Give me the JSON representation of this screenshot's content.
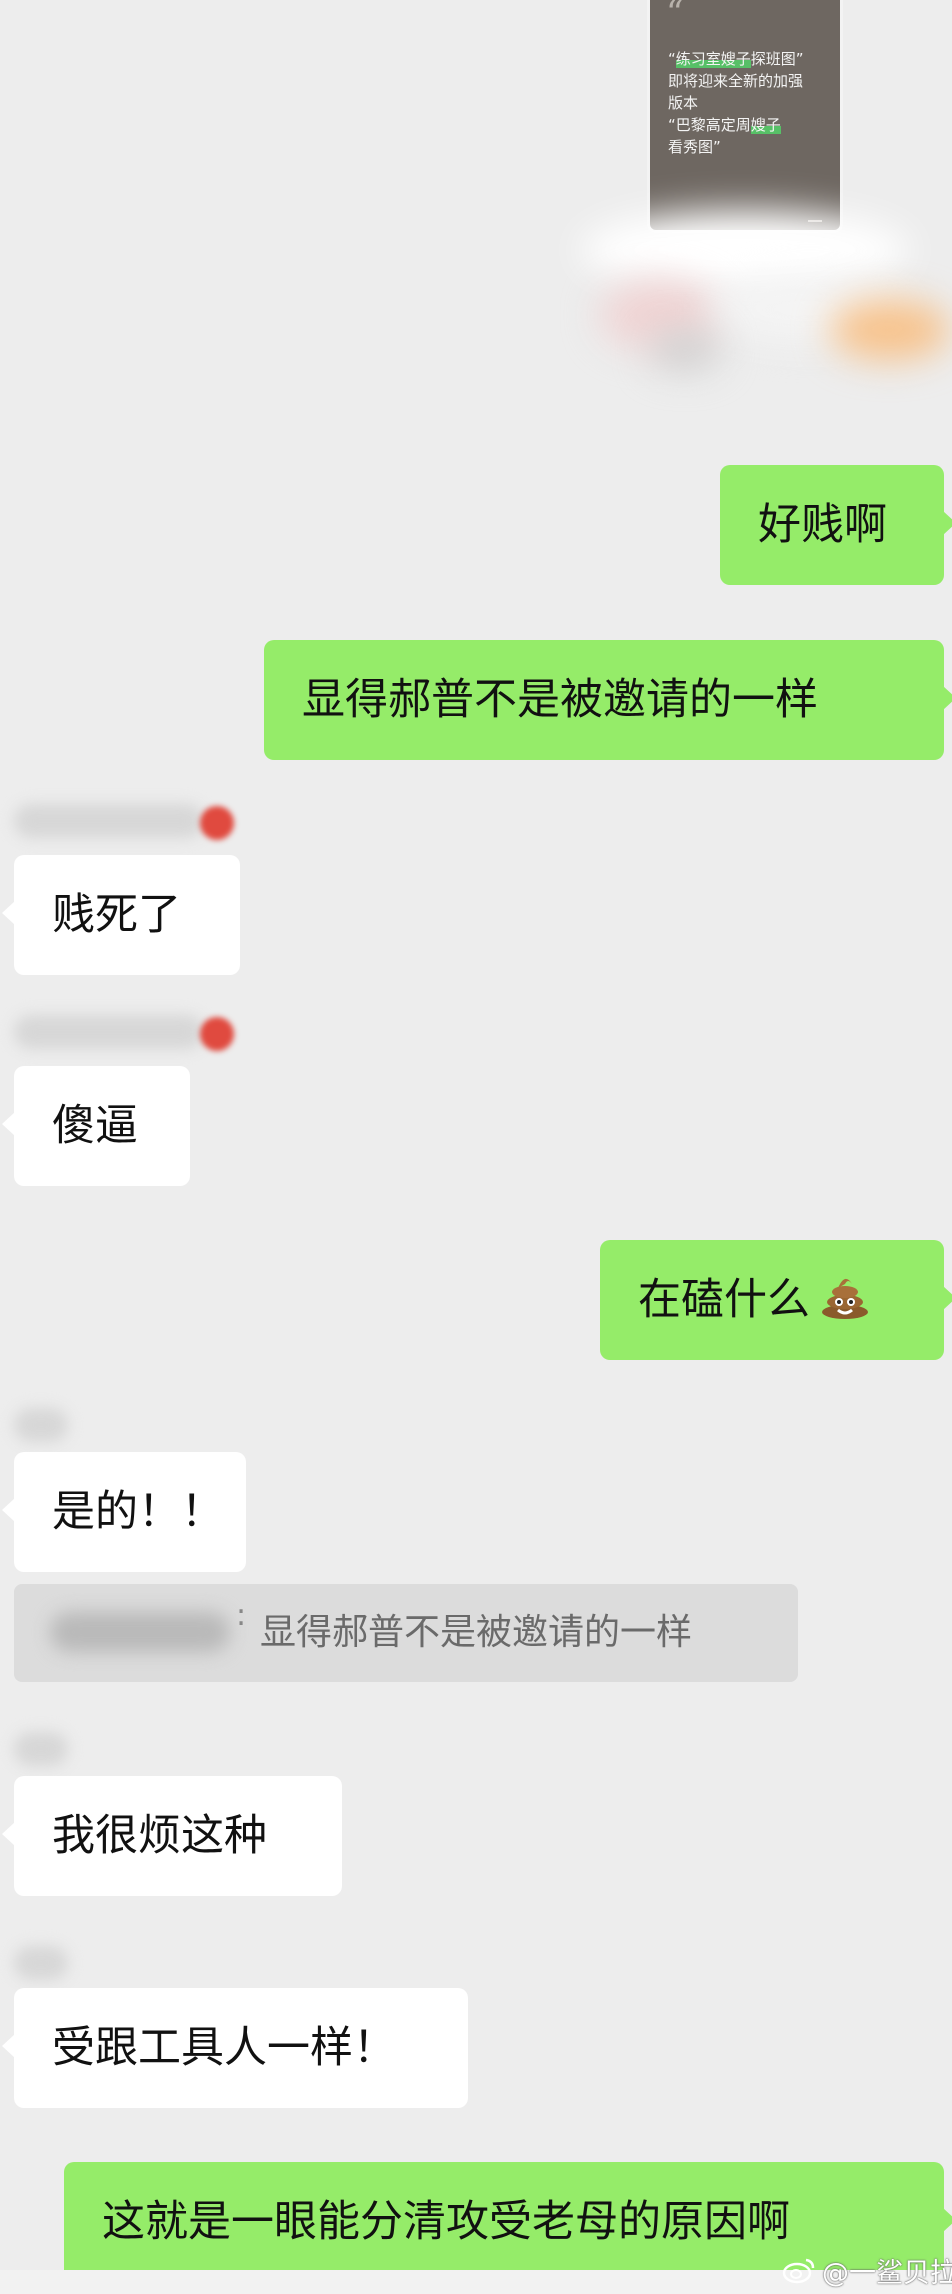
{
  "share_card": {
    "lines": [
      "“练习室嫂子探班图”",
      "即将迎来全新的加强",
      "版本",
      "“巴黎高定周嫂子",
      "看秀图”"
    ]
  },
  "messages": [
    {
      "side": "me",
      "text": "好贱啊"
    },
    {
      "side": "me",
      "text": "显得郝普不是被邀请的一样"
    },
    {
      "side": "other",
      "text": "贱死了"
    },
    {
      "side": "other",
      "text": "傻逼"
    },
    {
      "side": "me",
      "text": "在磕什么"
    },
    {
      "side": "other",
      "text": "是的！！"
    },
    {
      "side": "other",
      "text": "我很烦这种"
    },
    {
      "side": "other",
      "text": "受跟工具人一样！"
    },
    {
      "side": "me",
      "text": "这就是一眼能分清攻受老母的原因啊"
    }
  ],
  "quote_reply": {
    "separator": ":",
    "text": "显得郝普不是被邀请的一样"
  },
  "watermark": {
    "text": "@一鲨贝拉",
    "icon": "weibo-icon"
  },
  "colors": {
    "background": "#ededed",
    "my_bubble": "#95ec69",
    "other_bubble": "#ffffff"
  }
}
